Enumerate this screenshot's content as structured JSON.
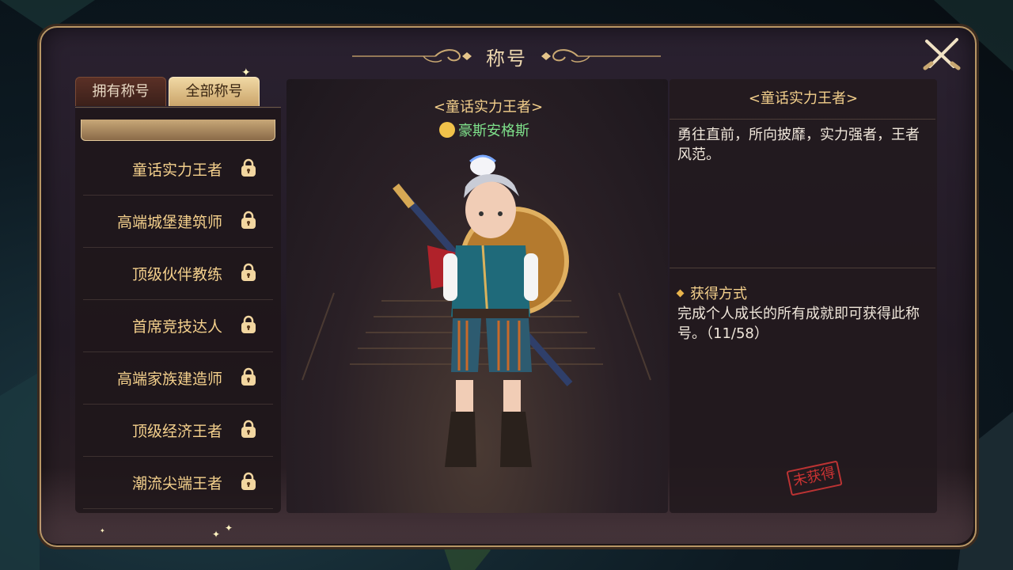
{
  "window": {
    "title": "称号",
    "close_icon": "close-crossed-swords-icon"
  },
  "tabs": [
    {
      "label": "拥有称号",
      "active": false
    },
    {
      "label": "全部称号",
      "active": true
    }
  ],
  "title_list": [
    {
      "label": "童话实力王者",
      "icon": "lock-icon"
    },
    {
      "label": "高端城堡建筑师",
      "icon": "lock-icon"
    },
    {
      "label": "顶级伙伴教练",
      "icon": "lock-icon"
    },
    {
      "label": "首席竞技达人",
      "icon": "lock-icon"
    },
    {
      "label": "高端家族建造师",
      "icon": "lock-icon"
    },
    {
      "label": "顶级经济王者",
      "icon": "lock-icon"
    },
    {
      "label": "潮流尖端王者",
      "icon": "lock-icon"
    }
  ],
  "preview": {
    "title_tag": "<童话实力王者>",
    "character_name": "豪斯安格斯"
  },
  "detail": {
    "title": "<童话实力王者>",
    "description": "勇往直前，所向披靡，实力强者，王者风范。",
    "how_to_get_label": "获得方式",
    "how_to_get_text": "完成个人成长的所有成就即可获得此称号。（11/58）",
    "status_stamp": "未获得"
  },
  "colors": {
    "gold_text": "#f4d08c",
    "green_name": "#7ee08a",
    "panel_border": "#b89665",
    "stamp_red": "#c33333"
  }
}
